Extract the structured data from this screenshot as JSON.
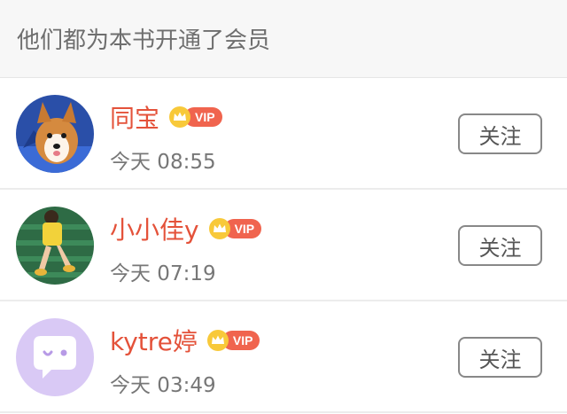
{
  "header": {
    "title": "他们都为本书开通了会员"
  },
  "vip_label": "VIP",
  "colors": {
    "name": "#e4523a",
    "vip": "#f0644e",
    "crown": "#f5b822"
  },
  "members": [
    {
      "name": "同宝",
      "time": "今天 08:55",
      "follow_label": "关注",
      "avatar": "corgi-puppy-photo"
    },
    {
      "name": "小小佳y",
      "time": "今天 07:19",
      "follow_label": "关注",
      "avatar": "girl-on-stairs-photo"
    },
    {
      "name": "kytre婷",
      "time": "今天 03:49",
      "follow_label": "关注",
      "avatar": "chat-bubble-icon"
    }
  ]
}
